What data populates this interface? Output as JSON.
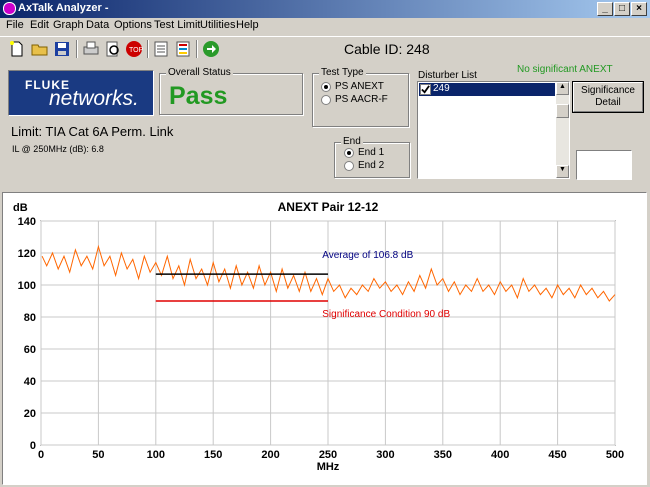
{
  "window": {
    "title": "AxTalk Analyzer -",
    "min": "_",
    "max": "□",
    "close": "×"
  },
  "menu": [
    "File",
    "Edit",
    "Graph",
    "Data",
    "Options",
    "Test Limit",
    "Utilities",
    "Help"
  ],
  "toolbar": {
    "icons": [
      "new-icon",
      "open-icon",
      "save-icon",
      "print-icon",
      "print-preview-icon",
      "report-icon",
      "document-icon",
      "list-icon",
      "go-icon"
    ],
    "cable_id": "Cable ID: 248"
  },
  "logo": {
    "line1": "FLUKE",
    "line2": "networks."
  },
  "overall_status": {
    "title": "Overall Status",
    "value": "Pass"
  },
  "test_type": {
    "title": "Test Type",
    "options": [
      "PS ANEXT",
      "PS AACR-F"
    ],
    "selected": 0
  },
  "end": {
    "title": "End",
    "options": [
      "End 1",
      "End 2"
    ],
    "selected": 0
  },
  "disturber": {
    "title": "Disturber List",
    "items": [
      "249"
    ],
    "checked": true,
    "no_anext": "No significant ANEXT"
  },
  "significance_button": {
    "line1": "Significance",
    "line2": "Detail"
  },
  "limit_text": "Limit: TIA Cat 6A Perm. Link",
  "il_text": "IL @ 250MHz (dB):  6.8",
  "chart_data": {
    "type": "line",
    "title": "ANEXT Pair 12-12",
    "ylabel": "dB",
    "xlabel": "MHz",
    "xlim": [
      0,
      500
    ],
    "ylim": [
      0,
      140
    ],
    "xticks": [
      0,
      50,
      100,
      150,
      200,
      250,
      300,
      350,
      400,
      450,
      500
    ],
    "yticks": [
      0,
      20,
      40,
      60,
      80,
      100,
      120,
      140
    ],
    "grid": true,
    "series_color": "#ff6600",
    "average": {
      "label": "Average of 106.8 dB",
      "value": 106.8,
      "x": [
        100,
        250
      ],
      "color": "#000000",
      "label_color": "#000080"
    },
    "significance": {
      "label": "Significance Condition 90 dB",
      "value": 90,
      "x": [
        100,
        250
      ],
      "color": "#e00000"
    },
    "points": [
      [
        1,
        118
      ],
      [
        5,
        112
      ],
      [
        10,
        120
      ],
      [
        15,
        110
      ],
      [
        20,
        118
      ],
      [
        25,
        108
      ],
      [
        30,
        122
      ],
      [
        35,
        112
      ],
      [
        40,
        118
      ],
      [
        45,
        110
      ],
      [
        50,
        124
      ],
      [
        55,
        112
      ],
      [
        60,
        118
      ],
      [
        65,
        106
      ],
      [
        70,
        120
      ],
      [
        75,
        110
      ],
      [
        80,
        116
      ],
      [
        85,
        104
      ],
      [
        90,
        118
      ],
      [
        95,
        108
      ],
      [
        100,
        114
      ],
      [
        105,
        106
      ],
      [
        110,
        118
      ],
      [
        115,
        104
      ],
      [
        120,
        112
      ],
      [
        125,
        100
      ],
      [
        130,
        116
      ],
      [
        135,
        104
      ],
      [
        140,
        110
      ],
      [
        145,
        100
      ],
      [
        150,
        114
      ],
      [
        155,
        102
      ],
      [
        160,
        110
      ],
      [
        165,
        98
      ],
      [
        170,
        112
      ],
      [
        175,
        100
      ],
      [
        180,
        108
      ],
      [
        185,
        98
      ],
      [
        190,
        112
      ],
      [
        195,
        100
      ],
      [
        200,
        108
      ],
      [
        205,
        96
      ],
      [
        210,
        110
      ],
      [
        215,
        98
      ],
      [
        220,
        106
      ],
      [
        225,
        96
      ],
      [
        230,
        108
      ],
      [
        235,
        96
      ],
      [
        240,
        104
      ],
      [
        245,
        94
      ],
      [
        250,
        104
      ],
      [
        255,
        96
      ],
      [
        260,
        100
      ],
      [
        265,
        92
      ],
      [
        270,
        98
      ],
      [
        275,
        94
      ],
      [
        280,
        100
      ],
      [
        285,
        96
      ],
      [
        290,
        104
      ],
      [
        295,
        98
      ],
      [
        300,
        102
      ],
      [
        305,
        96
      ],
      [
        310,
        100
      ],
      [
        315,
        94
      ],
      [
        320,
        102
      ],
      [
        325,
        96
      ],
      [
        330,
        106
      ],
      [
        335,
        98
      ],
      [
        340,
        110
      ],
      [
        345,
        100
      ],
      [
        350,
        104
      ],
      [
        355,
        96
      ],
      [
        360,
        102
      ],
      [
        365,
        94
      ],
      [
        370,
        100
      ],
      [
        375,
        96
      ],
      [
        380,
        104
      ],
      [
        385,
        96
      ],
      [
        390,
        100
      ],
      [
        395,
        94
      ],
      [
        400,
        102
      ],
      [
        405,
        96
      ],
      [
        410,
        100
      ],
      [
        415,
        92
      ],
      [
        420,
        104
      ],
      [
        425,
        96
      ],
      [
        430,
        100
      ],
      [
        435,
        94
      ],
      [
        440,
        98
      ],
      [
        445,
        92
      ],
      [
        450,
        100
      ],
      [
        455,
        94
      ],
      [
        460,
        98
      ],
      [
        465,
        92
      ],
      [
        470,
        100
      ],
      [
        475,
        94
      ],
      [
        480,
        98
      ],
      [
        485,
        92
      ],
      [
        490,
        96
      ],
      [
        495,
        90
      ],
      [
        500,
        94
      ]
    ]
  }
}
